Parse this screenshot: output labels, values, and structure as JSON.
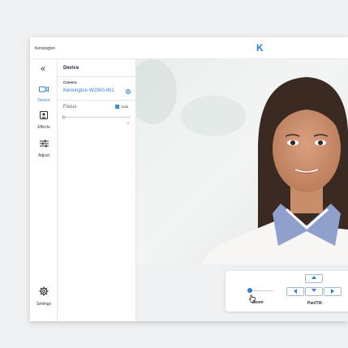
{
  "window": {
    "app_name": "Kensington",
    "logo_letter": "K"
  },
  "rail": {
    "collapse_glyph": "«",
    "items": [
      {
        "label": "Device",
        "icon": "camera-icon",
        "active": true
      },
      {
        "label": "Effects",
        "icon": "portrait-icon",
        "active": false
      },
      {
        "label": "Adjust",
        "icon": "sliders-icon",
        "active": false
      },
      {
        "label": "Settings",
        "icon": "gear-icon",
        "active": false
      }
    ]
  },
  "panel": {
    "title": "Device",
    "camera_label": "Camera",
    "camera_value": "Kensington W2000-001",
    "focus_label": "Focus",
    "auto_label": "Auto",
    "auto_checked": true,
    "focus_value": "0"
  },
  "controls": {
    "zoom_label": "Zoom",
    "zoom_level": 0.1,
    "pantilt_label": "Pan/Tilt"
  },
  "colors": {
    "accent": "#2d7fd3",
    "background": "#eff0f2"
  }
}
